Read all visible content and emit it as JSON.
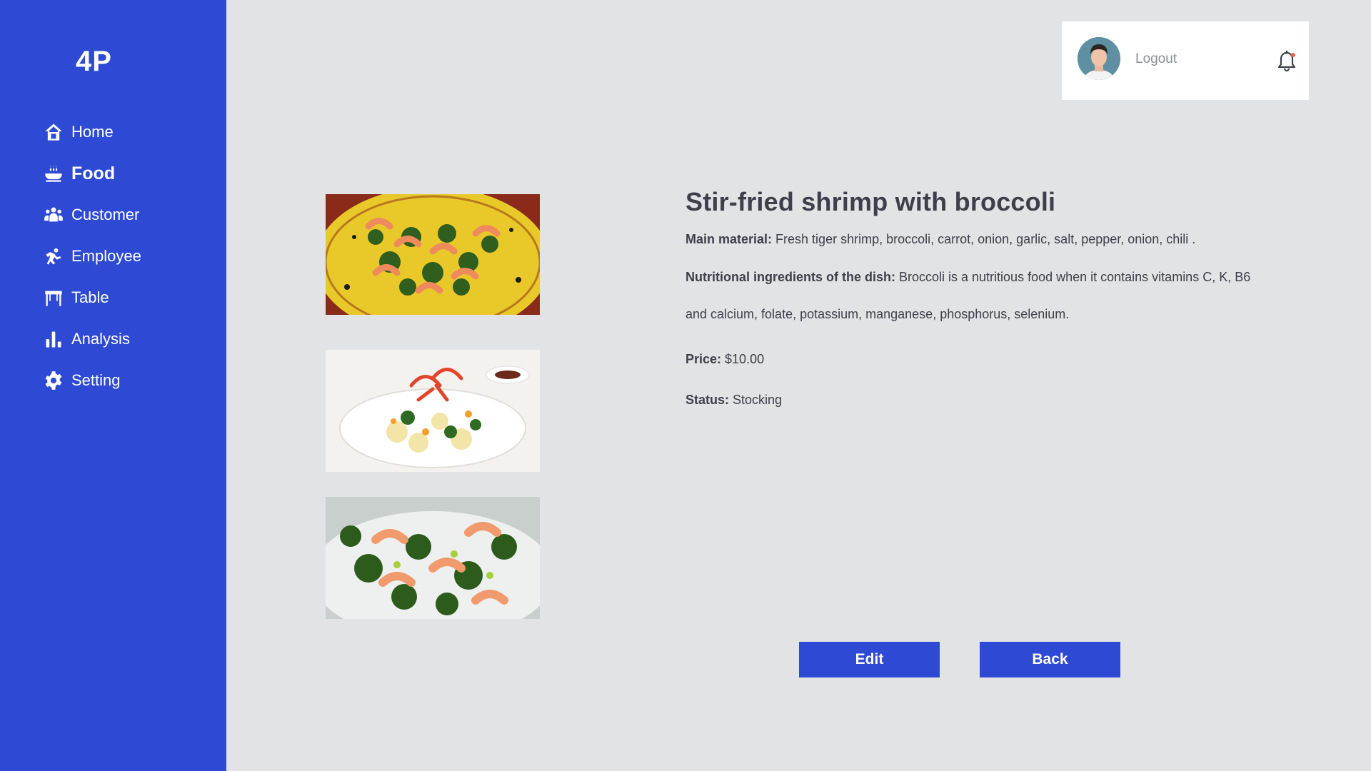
{
  "app": {
    "logo": "4P"
  },
  "sidebar": {
    "items": [
      {
        "label": "Home",
        "icon": "home-icon",
        "active": false
      },
      {
        "label": "Food",
        "icon": "food-bowl-icon",
        "active": true
      },
      {
        "label": "Customer",
        "icon": "customer-group-icon",
        "active": false
      },
      {
        "label": "Employee",
        "icon": "employee-icon",
        "active": false
      },
      {
        "label": "Table",
        "icon": "table-icon",
        "active": false
      },
      {
        "label": "Analysis",
        "icon": "bar-chart-icon",
        "active": false
      },
      {
        "label": "Setting",
        "icon": "gear-icon",
        "active": false
      }
    ]
  },
  "header": {
    "logout_label": "Logout",
    "notification_icon": "bell-icon"
  },
  "dish": {
    "title": "Stir-fried shrimp with broccoli",
    "main_material_label": "Main material:",
    "main_material_value": " Fresh tiger shrimp, broccoli, carrot, onion, garlic, salt, pepper, onion, chili .",
    "nutrition_label": "Nutritional ingredients of the dish:",
    "nutrition_value": "  Broccoli is a nutritious food when it contains vitamins C, K, B6 and calcium, folate, potassium, manganese, phosphorus, selenium.",
    "price_label": "Price:",
    "price_value": " $10.00",
    "status_label": "Status:",
    "status_value": " Stocking"
  },
  "actions": {
    "edit_label": "Edit",
    "back_label": "Back"
  },
  "colors": {
    "accent": "#2e4ad4",
    "background": "#e2e3e5",
    "text": "#3e3f4a"
  }
}
